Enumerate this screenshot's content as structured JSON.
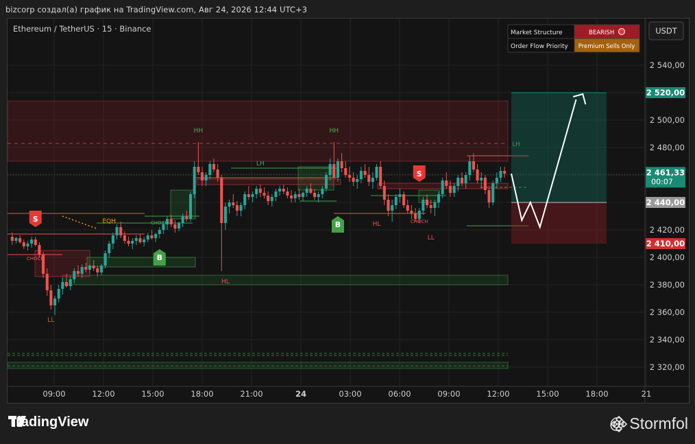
{
  "header": {
    "attribution": "bizcorp создал(а) график на TradingView.com, Авг 24, 2026 12:44 UTC+3"
  },
  "symbol": {
    "title": "Ethereum / TetherUS · 15 · Binance"
  },
  "currency_button": "USDT",
  "info_table": {
    "rows": [
      {
        "label": "Market Structure",
        "value": "BEARISH",
        "color": "#9e1c25"
      },
      {
        "label": "Order Flow Priority",
        "value": "Premium Sells Only",
        "color": "#a5610f"
      }
    ]
  },
  "footer": {
    "brand": "TradingView",
    "author": "@ Stormfol"
  },
  "colors": {
    "up": "#26a69a",
    "down": "#ef5350",
    "buy": "#43a047",
    "sell": "#e53935"
  },
  "chart_data": {
    "type": "candlestick",
    "ylim": [
      2310,
      2560
    ],
    "y_ticks": [
      2320,
      2340,
      2360,
      2380,
      2400,
      2420,
      2440,
      2460,
      2480,
      2500,
      2520,
      2540
    ],
    "y_tick_labels": [
      "2 320,00",
      "2 340,00",
      "2 360,00",
      "2 380,00",
      "2 400,00",
      "2 420,00",
      "2 440,00",
      "2 460,00",
      "2 480,00",
      "2 500,00",
      "2 520,00",
      "2 540,00"
    ],
    "x_ticks": [
      "09:00",
      "12:00",
      "15:00",
      "18:00",
      "21:00",
      "24",
      "03:00",
      "06:00",
      "09:00",
      "12:00",
      "15:00",
      "18:00",
      "21"
    ],
    "price_markers": [
      {
        "label": "2 520,00",
        "value": 2520,
        "color": "#1a8a73"
      },
      {
        "label": "2 461,33",
        "sub": "00:07",
        "value": 2461.33,
        "color": "#1a8a73"
      },
      {
        "label": "2 440,00",
        "value": 2440,
        "color": "#9a9a9a"
      },
      {
        "label": "2 410,00",
        "value": 2410,
        "color": "#d32f2f"
      }
    ],
    "candles": [
      [
        2415,
        2418,
        2409,
        2412
      ],
      [
        2412,
        2415,
        2410,
        2414
      ],
      [
        2414,
        2416,
        2410,
        2411
      ],
      [
        2411,
        2413,
        2406,
        2408
      ],
      [
        2408,
        2412,
        2405,
        2410
      ],
      [
        2410,
        2415,
        2407,
        2413
      ],
      [
        2413,
        2415,
        2408,
        2409
      ],
      [
        2409,
        2411,
        2400,
        2402
      ],
      [
        2402,
        2404,
        2385,
        2388
      ],
      [
        2388,
        2392,
        2372,
        2376
      ],
      [
        2376,
        2380,
        2362,
        2365
      ],
      [
        2365,
        2372,
        2358,
        2370
      ],
      [
        2370,
        2380,
        2367,
        2377
      ],
      [
        2377,
        2385,
        2373,
        2382
      ],
      [
        2382,
        2388,
        2378,
        2379
      ],
      [
        2379,
        2386,
        2376,
        2384
      ],
      [
        2384,
        2392,
        2381,
        2390
      ],
      [
        2390,
        2394,
        2386,
        2388
      ],
      [
        2388,
        2395,
        2385,
        2393
      ],
      [
        2393,
        2396,
        2389,
        2391
      ],
      [
        2391,
        2395,
        2388,
        2394
      ],
      [
        2394,
        2398,
        2390,
        2392
      ],
      [
        2392,
        2394,
        2386,
        2389
      ],
      [
        2389,
        2395,
        2387,
        2394
      ],
      [
        2394,
        2405,
        2392,
        2403
      ],
      [
        2403,
        2412,
        2400,
        2410
      ],
      [
        2410,
        2418,
        2406,
        2416
      ],
      [
        2416,
        2424,
        2413,
        2422
      ],
      [
        2422,
        2426,
        2414,
        2416
      ],
      [
        2416,
        2419,
        2410,
        2412
      ],
      [
        2412,
        2415,
        2408,
        2410
      ],
      [
        2410,
        2414,
        2406,
        2412
      ],
      [
        2412,
        2416,
        2409,
        2414
      ],
      [
        2414,
        2417,
        2410,
        2411
      ],
      [
        2411,
        2415,
        2408,
        2413
      ],
      [
        2413,
        2418,
        2411,
        2416
      ],
      [
        2416,
        2420,
        2413,
        2414
      ],
      [
        2414,
        2418,
        2411,
        2417
      ],
      [
        2417,
        2422,
        2414,
        2420
      ],
      [
        2420,
        2426,
        2417,
        2424
      ],
      [
        2424,
        2430,
        2420,
        2428
      ],
      [
        2428,
        2431,
        2422,
        2424
      ],
      [
        2424,
        2427,
        2418,
        2421
      ],
      [
        2421,
        2426,
        2419,
        2425
      ],
      [
        2425,
        2432,
        2422,
        2430
      ],
      [
        2430,
        2434,
        2426,
        2428
      ],
      [
        2428,
        2448,
        2426,
        2446
      ],
      [
        2446,
        2470,
        2443,
        2466
      ],
      [
        2466,
        2484,
        2460,
        2462
      ],
      [
        2462,
        2466,
        2452,
        2456
      ],
      [
        2456,
        2462,
        2452,
        2460
      ],
      [
        2460,
        2470,
        2457,
        2468
      ],
      [
        2468,
        2472,
        2462,
        2464
      ],
      [
        2464,
        2468,
        2455,
        2458
      ],
      [
        2458,
        2460,
        2390,
        2425
      ],
      [
        2425,
        2440,
        2420,
        2437
      ],
      [
        2437,
        2442,
        2432,
        2440
      ],
      [
        2440,
        2446,
        2436,
        2438
      ],
      [
        2438,
        2441,
        2430,
        2434
      ],
      [
        2434,
        2440,
        2430,
        2438
      ],
      [
        2438,
        2448,
        2435,
        2446
      ],
      [
        2446,
        2452,
        2442,
        2444
      ],
      [
        2444,
        2448,
        2440,
        2446
      ],
      [
        2446,
        2452,
        2443,
        2450
      ],
      [
        2450,
        2453,
        2444,
        2447
      ],
      [
        2447,
        2451,
        2443,
        2445
      ],
      [
        2445,
        2448,
        2438,
        2441
      ],
      [
        2441,
        2446,
        2437,
        2444
      ],
      [
        2444,
        2450,
        2441,
        2448
      ],
      [
        2448,
        2452,
        2445,
        2450
      ],
      [
        2450,
        2453,
        2446,
        2448
      ],
      [
        2448,
        2451,
        2443,
        2445
      ],
      [
        2445,
        2449,
        2440,
        2443
      ],
      [
        2443,
        2448,
        2440,
        2446
      ],
      [
        2446,
        2450,
        2442,
        2444
      ],
      [
        2444,
        2448,
        2441,
        2447
      ],
      [
        2447,
        2452,
        2444,
        2450
      ],
      [
        2450,
        2454,
        2446,
        2447
      ],
      [
        2447,
        2450,
        2442,
        2444
      ],
      [
        2444,
        2448,
        2440,
        2446
      ],
      [
        2446,
        2452,
        2443,
        2450
      ],
      [
        2450,
        2462,
        2448,
        2460
      ],
      [
        2460,
        2472,
        2456,
        2468
      ],
      [
        2468,
        2484,
        2462,
        2458
      ],
      [
        2458,
        2472,
        2455,
        2470
      ],
      [
        2470,
        2476,
        2462,
        2465
      ],
      [
        2465,
        2470,
        2458,
        2460
      ],
      [
        2460,
        2466,
        2455,
        2458
      ],
      [
        2458,
        2462,
        2452,
        2455
      ],
      [
        2455,
        2460,
        2450,
        2457
      ],
      [
        2457,
        2466,
        2454,
        2463
      ],
      [
        2463,
        2468,
        2458,
        2460
      ],
      [
        2460,
        2466,
        2452,
        2455
      ],
      [
        2455,
        2462,
        2450,
        2458
      ],
      [
        2458,
        2468,
        2456,
        2466
      ],
      [
        2466,
        2470,
        2450,
        2452
      ],
      [
        2452,
        2456,
        2438,
        2442
      ],
      [
        2442,
        2446,
        2430,
        2434
      ],
      [
        2434,
        2442,
        2426,
        2438
      ],
      [
        2438,
        2446,
        2435,
        2444
      ],
      [
        2444,
        2450,
        2440,
        2446
      ],
      [
        2446,
        2448,
        2436,
        2438
      ],
      [
        2438,
        2442,
        2432,
        2434
      ],
      [
        2434,
        2438,
        2428,
        2432
      ],
      [
        2432,
        2436,
        2426,
        2428
      ],
      [
        2428,
        2436,
        2425,
        2434
      ],
      [
        2434,
        2444,
        2431,
        2442
      ],
      [
        2442,
        2446,
        2436,
        2438
      ],
      [
        2438,
        2442,
        2432,
        2436
      ],
      [
        2436,
        2442,
        2430,
        2440
      ],
      [
        2440,
        2448,
        2436,
        2446
      ],
      [
        2446,
        2458,
        2443,
        2456
      ],
      [
        2456,
        2462,
        2450,
        2452
      ],
      [
        2452,
        2456,
        2444,
        2447
      ],
      [
        2447,
        2454,
        2444,
        2452
      ],
      [
        2452,
        2460,
        2448,
        2458
      ],
      [
        2458,
        2462,
        2452,
        2454
      ],
      [
        2454,
        2462,
        2450,
        2460
      ],
      [
        2460,
        2474,
        2456,
        2470
      ],
      [
        2470,
        2476,
        2462,
        2464
      ],
      [
        2464,
        2468,
        2454,
        2456
      ],
      [
        2456,
        2462,
        2450,
        2458
      ],
      [
        2458,
        2460,
        2446,
        2449
      ],
      [
        2449,
        2452,
        2436,
        2440
      ],
      [
        2440,
        2456,
        2438,
        2454
      ],
      [
        2454,
        2462,
        2450,
        2458
      ],
      [
        2458,
        2466,
        2455,
        2463
      ],
      [
        2463,
        2466,
        2458,
        2461
      ]
    ],
    "zones": [
      {
        "kind": "supply",
        "y1": 2514,
        "y2": 2470,
        "t1": 0,
        "t2": 1
      },
      {
        "kind": "demand-bottom",
        "y1": 2387,
        "y2": 2381,
        "t1": 0.1,
        "t2": 1
      }
    ],
    "labels": [
      {
        "text": "HH",
        "i": 48,
        "v": 2491,
        "color": "#4caf50"
      },
      {
        "text": "HH",
        "i": 83,
        "v": 2491,
        "color": "#4caf50"
      },
      {
        "text": "LH",
        "i": 64,
        "v": 2467,
        "color": "#4caf50"
      },
      {
        "text": "LH",
        "i": 130,
        "v": 2481,
        "color": "#4caf50"
      },
      {
        "text": "LL",
        "i": 10,
        "v": 2353,
        "color": "#ef5350"
      },
      {
        "text": "LL",
        "i": 108,
        "v": 2413,
        "color": "#ef5350"
      },
      {
        "text": "HL",
        "i": 94,
        "v": 2423,
        "color": "#ef5350"
      },
      {
        "text": "HL",
        "i": 55,
        "v": 2381,
        "color": "#ef5350"
      },
      {
        "text": "CHOCH",
        "i": 6,
        "v": 2398,
        "color": "#ef5350"
      },
      {
        "text": "CHOCH",
        "i": 38,
        "v": 2424,
        "color": "#4caf50"
      },
      {
        "text": "CHOCH",
        "i": 105,
        "v": 2425,
        "color": "#ef5350"
      },
      {
        "text": "EQH",
        "i": 25,
        "v": 2425,
        "color": "#ff9800"
      }
    ],
    "signals": [
      {
        "text": "S",
        "i": 6,
        "v": 2427,
        "kind": "sell"
      },
      {
        "text": "S",
        "i": 105,
        "v": 2460,
        "kind": "sell"
      },
      {
        "text": "B",
        "i": 38,
        "v": 2399,
        "kind": "buy"
      },
      {
        "text": "B",
        "i": 84,
        "v": 2423,
        "kind": "buy"
      }
    ],
    "projection": {
      "target": 2520,
      "entry": 2440,
      "stop": 2410,
      "path": [
        [
          0,
          2461
        ],
        [
          0.11,
          2427
        ],
        [
          0.2,
          2440
        ],
        [
          0.3,
          2422
        ],
        [
          0.68,
          2515
        ]
      ],
      "arrow_tip": [
        0.75,
        2519
      ]
    }
  }
}
